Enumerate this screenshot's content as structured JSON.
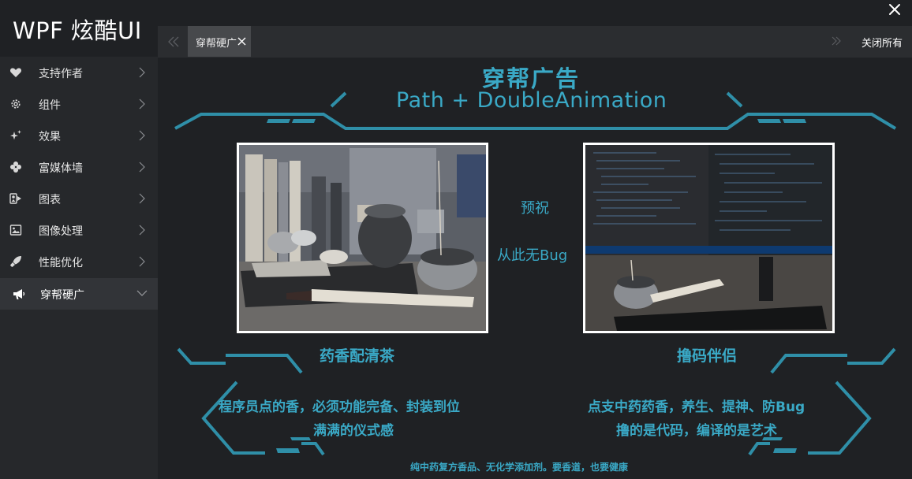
{
  "app": {
    "title": "WPF 炫酷UI"
  },
  "sidebar": {
    "items": [
      {
        "label": "支持作者",
        "icon": "heart-icon"
      },
      {
        "label": "组件",
        "icon": "gear-icon"
      },
      {
        "label": "效果",
        "icon": "sparkle-icon"
      },
      {
        "label": "富媒体墙",
        "icon": "clover-icon"
      },
      {
        "label": "图表",
        "icon": "chart-icon"
      },
      {
        "label": "图像处理",
        "icon": "image-icon"
      },
      {
        "label": "性能优化",
        "icon": "rocket-icon"
      },
      {
        "label": "穿帮硬广",
        "icon": "megaphone-icon"
      }
    ],
    "active_index": 7
  },
  "tabs": [
    {
      "label": "穿帮硬广"
    }
  ],
  "toolbar": {
    "close_all_label": "关闭所有"
  },
  "content": {
    "title": "穿帮广告",
    "subtitle": "Path + DoubleAnimation",
    "center_line1": "预祝",
    "center_line2": "从此无Bug",
    "left_caption": "药香配清茶",
    "right_caption": "撸码伴侣",
    "left_desc_line1": "程序员点的香，必须功能完备、封装到位",
    "left_desc_line2": "满满的仪式感",
    "right_desc_line1": "点支中药药香，养生、提神、防Bug",
    "right_desc_line2": "撸的是代码，编译的是艺术",
    "footer": "纯中药复方香品、无化学添加剂。要香道，也要健康"
  },
  "colors": {
    "accent": "#2f8fa8",
    "text_accent": "#3aa9c6",
    "background": "#1f2124",
    "sidebar": "#26282b"
  }
}
